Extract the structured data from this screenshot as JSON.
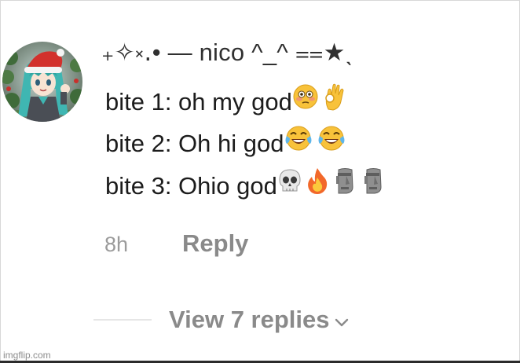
{
  "comment": {
    "username": "₊✧༝․• — nico ^_^ ⩵★ˎ",
    "lines": [
      {
        "text": "bite 1: oh my god",
        "emojis": [
          "flushed-face",
          "ok-hand"
        ]
      },
      {
        "text": "bite 2: Oh hi god",
        "emojis": [
          "tears-of-joy",
          "tears-of-joy"
        ]
      },
      {
        "text": "bite 3: Ohio god",
        "emojis": [
          "skull",
          "fire",
          "moai",
          "moai"
        ]
      }
    ],
    "timestamp": "8h",
    "reply_label": "Reply",
    "view_replies_label": "View 7 replies"
  },
  "watermark": "imgflip.com",
  "colors": {
    "text": "#1c1c1c",
    "muted": "#8a8a8a",
    "timestamp": "#9b9b9b"
  }
}
